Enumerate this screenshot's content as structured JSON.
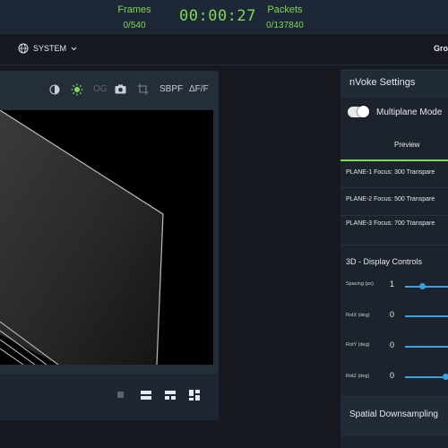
{
  "topbar": {
    "frames_label": "Frames",
    "frames_value": "0/540",
    "timer": "00:00:27",
    "packets_label": "Packets",
    "packets_value": "0/137840"
  },
  "subbar": {
    "system_label": "SYSTEM",
    "right_label": "Gro"
  },
  "viewer": {
    "tools": [
      "OG",
      "SBPF",
      "ΔF/F"
    ]
  },
  "settings": {
    "title": "nVoke Settings",
    "multiplane_label": "Multiplane Mode",
    "multiplane_on": true,
    "tab_preview": "Preview",
    "planes": [
      "PLANE-1 Focus: 300 Transpare",
      "PLANE-2 Focus: 500 Transpare",
      "PLANE-3 Focus: 700 Transpare"
    ],
    "display_title": "3D - Display Controls",
    "controls": [
      {
        "label": "Spacing (px)",
        "value": "1"
      },
      {
        "label": "RotX (deg)",
        "value": "0"
      },
      {
        "label": "RotY (deg)",
        "value": "0"
      },
      {
        "label": "RotZ (deg)",
        "value": "0"
      }
    ],
    "spatial_label": "Spatial Downsampling",
    "accent_color": "#7ed957",
    "slider_color": "#3aa0df"
  }
}
